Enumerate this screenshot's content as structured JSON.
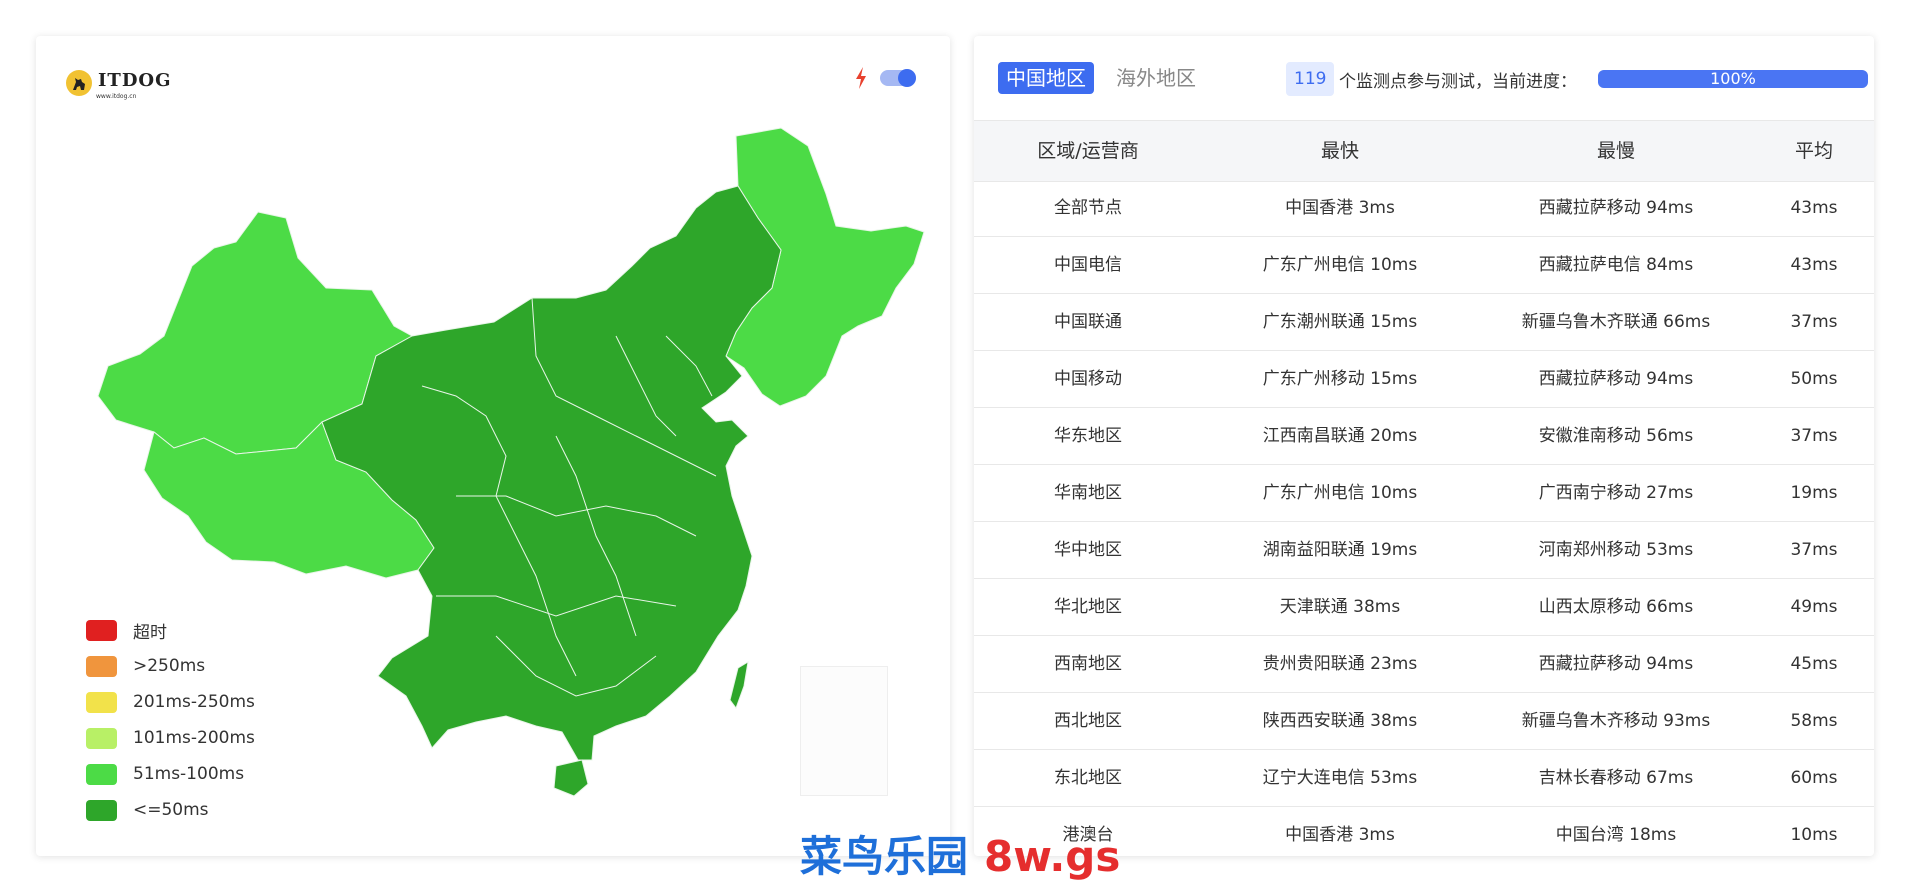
{
  "logo": {
    "text": "ITDOG",
    "subtext": "www.itdog.cn"
  },
  "map": {
    "legend": [
      {
        "label": "超时",
        "color": "#e02020"
      },
      {
        "label": ">250ms",
        "color": "#f0953d"
      },
      {
        "label": "201ms-250ms",
        "color": "#f2e24a"
      },
      {
        "label": "101ms-200ms",
        "color": "#b8f066"
      },
      {
        "label": "51ms-100ms",
        "color": "#4cdb46"
      },
      {
        "label": "<=50ms",
        "color": "#2ea62a"
      }
    ]
  },
  "tabs": [
    {
      "label": "中国地区",
      "active": true
    },
    {
      "label": "海外地区",
      "active": false
    }
  ],
  "status": {
    "count": "119",
    "count_text": "个监测点参与测试，当前进度：",
    "progress_label": "100%",
    "progress_value": 100
  },
  "table": {
    "headers": [
      "区域/运营商",
      "最快",
      "最慢",
      "平均"
    ],
    "rows": [
      [
        "全部节点",
        "中国香港 3ms",
        "西藏拉萨移动 94ms",
        "43ms"
      ],
      [
        "中国电信",
        "广东广州电信 10ms",
        "西藏拉萨电信 84ms",
        "43ms"
      ],
      [
        "中国联通",
        "广东潮州联通 15ms",
        "新疆乌鲁木齐联通 66ms",
        "37ms"
      ],
      [
        "中国移动",
        "广东广州移动 15ms",
        "西藏拉萨移动 94ms",
        "50ms"
      ],
      [
        "华东地区",
        "江西南昌联通 20ms",
        "安徽淮南移动 56ms",
        "37ms"
      ],
      [
        "华南地区",
        "广东广州电信 10ms",
        "广西南宁移动 27ms",
        "19ms"
      ],
      [
        "华中地区",
        "湖南益阳联通 19ms",
        "河南郑州移动 53ms",
        "37ms"
      ],
      [
        "华北地区",
        "天津联通 38ms",
        "山西太原移动 66ms",
        "49ms"
      ],
      [
        "西南地区",
        "贵州贵阳联通 23ms",
        "西藏拉萨移动 94ms",
        "45ms"
      ],
      [
        "西北地区",
        "陕西西安联通 38ms",
        "新疆乌鲁木齐移动 93ms",
        "58ms"
      ],
      [
        "东北地区",
        "辽宁大连电信 53ms",
        "吉林长春移动 67ms",
        "60ms"
      ],
      [
        "港澳台",
        "中国香港 3ms",
        "中国台湾 18ms",
        "10ms"
      ]
    ]
  },
  "watermark": {
    "cn": "菜鸟乐园",
    "en": "8w.gs"
  }
}
